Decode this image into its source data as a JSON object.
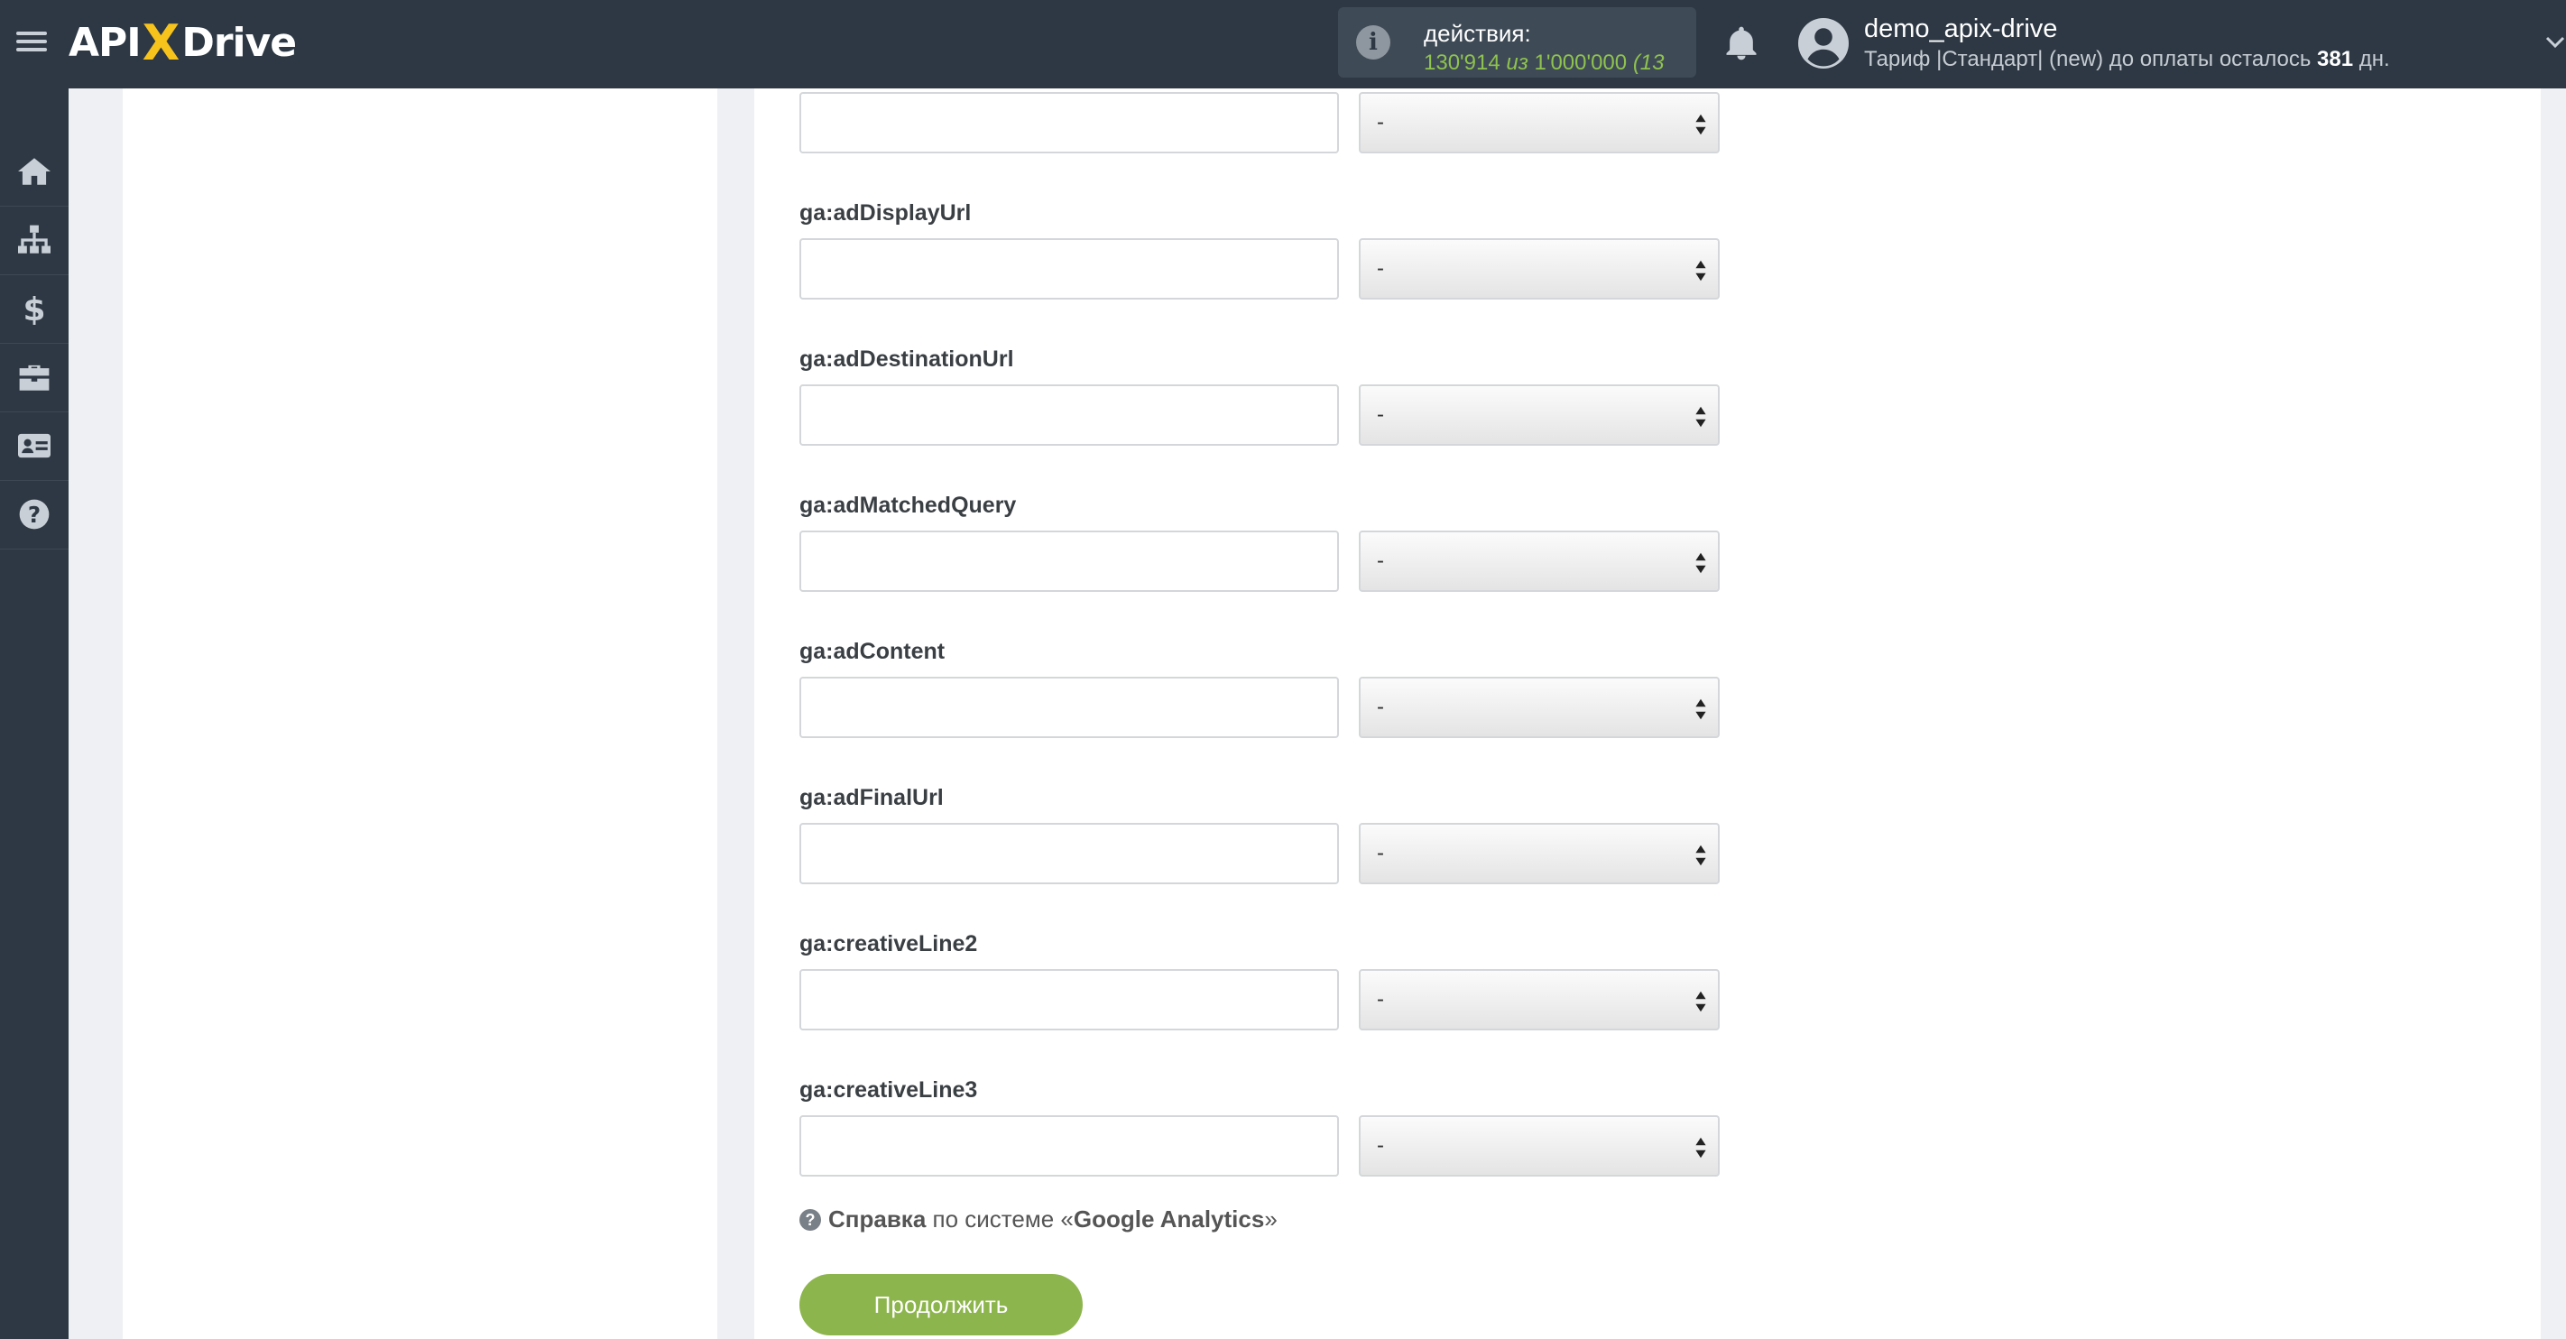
{
  "header": {
    "logo": {
      "part1": "API",
      "x": "X",
      "part2": "Drive"
    },
    "actions": {
      "label": "действия:",
      "used": "130'914",
      "of_word": "из",
      "total": "1'000'000",
      "extra": "(13"
    },
    "user": {
      "name": "demo_apix-drive",
      "tariff_prefix": "Тариф |Стандарт| (new) до оплаты осталось",
      "days": "381",
      "days_suffix": "дн."
    }
  },
  "sidebar": {
    "items": [
      {
        "icon": "home-icon"
      },
      {
        "icon": "sitemap-icon"
      },
      {
        "icon": "dollar-icon"
      },
      {
        "icon": "briefcase-icon"
      },
      {
        "icon": "id-card-icon"
      },
      {
        "icon": "help-circle-icon"
      }
    ]
  },
  "fields": [
    {
      "label": "",
      "value": "",
      "select": "-"
    },
    {
      "label": "ga:adDisplayUrl",
      "value": "",
      "select": "-"
    },
    {
      "label": "ga:adDestinationUrl",
      "value": "",
      "select": "-"
    },
    {
      "label": "ga:adMatchedQuery",
      "value": "",
      "select": "-"
    },
    {
      "label": "ga:adContent",
      "value": "",
      "select": "-"
    },
    {
      "label": "ga:adFinalUrl",
      "value": "",
      "select": "-"
    },
    {
      "label": "ga:creativeLine2",
      "value": "",
      "select": "-"
    },
    {
      "label": "ga:creativeLine3",
      "value": "",
      "select": "-"
    }
  ],
  "help": {
    "strong": "Справка",
    "middle": "по системе «",
    "system": "Google Analytics",
    "end": "»"
  },
  "continue_label": "Продолжить",
  "colors": {
    "header_bg": "#2d3844",
    "accent_green": "#8db54d",
    "logo_x": "#f6c21c",
    "counter_green": "#8fc24f"
  }
}
